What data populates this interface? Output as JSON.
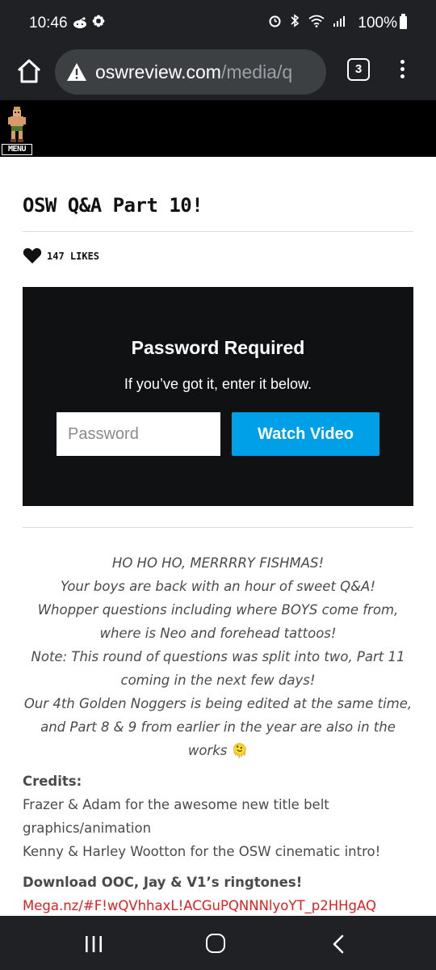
{
  "status_bar": {
    "time": "10:46",
    "battery": "100%",
    "left_icons": [
      "reddit-icon",
      "settings-flower-icon"
    ],
    "right_icons": [
      "alarm-icon",
      "bluetooth-icon",
      "wifi-icon",
      "signal-icon",
      "battery-icon"
    ]
  },
  "browser": {
    "url_host": "oswreview.com",
    "url_path": "/media/q",
    "tab_count": "3",
    "icons": [
      "home-icon",
      "warning-icon",
      "tabs-icon",
      "more-vert-icon"
    ]
  },
  "site": {
    "menu_label": "MENU"
  },
  "post": {
    "title": "OSW Q&A Part 10!",
    "likes": "147 LIKES"
  },
  "video": {
    "title": "Password Required",
    "subtitle": "If you’ve got it, enter it below.",
    "password_placeholder": "Password",
    "password_value": "",
    "button_label": "Watch Video",
    "accent_color": "#00a0e9"
  },
  "description": [
    "HO HO HO, MERRRRY FISHMAS!",
    "Your boys are back with an hour of sweet Q&A!",
    "Whopper questions including where BOYS come from, where is Neo and forehead tattoos!",
    "Note: This round of questions was split into two, Part 11 coming in the next few days!",
    "Our 4th Golden Noggers is being edited at the same time, and Part 8 & 9 from earlier in the year are also in the works"
  ],
  "description_emoji": "🫠",
  "credits": {
    "heading": "Credits:",
    "lines": [
      "Frazer & Adam for the awesome new title belt graphics/animation",
      "Kenny & Harley Wootton for the OSW cinematic intro!"
    ]
  },
  "download": {
    "heading": "Download OOC, Jay & V1’s ringtones!",
    "link": "Mega.nz/#F!wQVhhaxL!ACGuPQNNNlyoYT_p2HHgAQ",
    "link_color": "#e02020"
  },
  "nav_bar": {
    "icons": [
      "recent-apps-icon",
      "home-nav-icon",
      "back-icon"
    ]
  }
}
